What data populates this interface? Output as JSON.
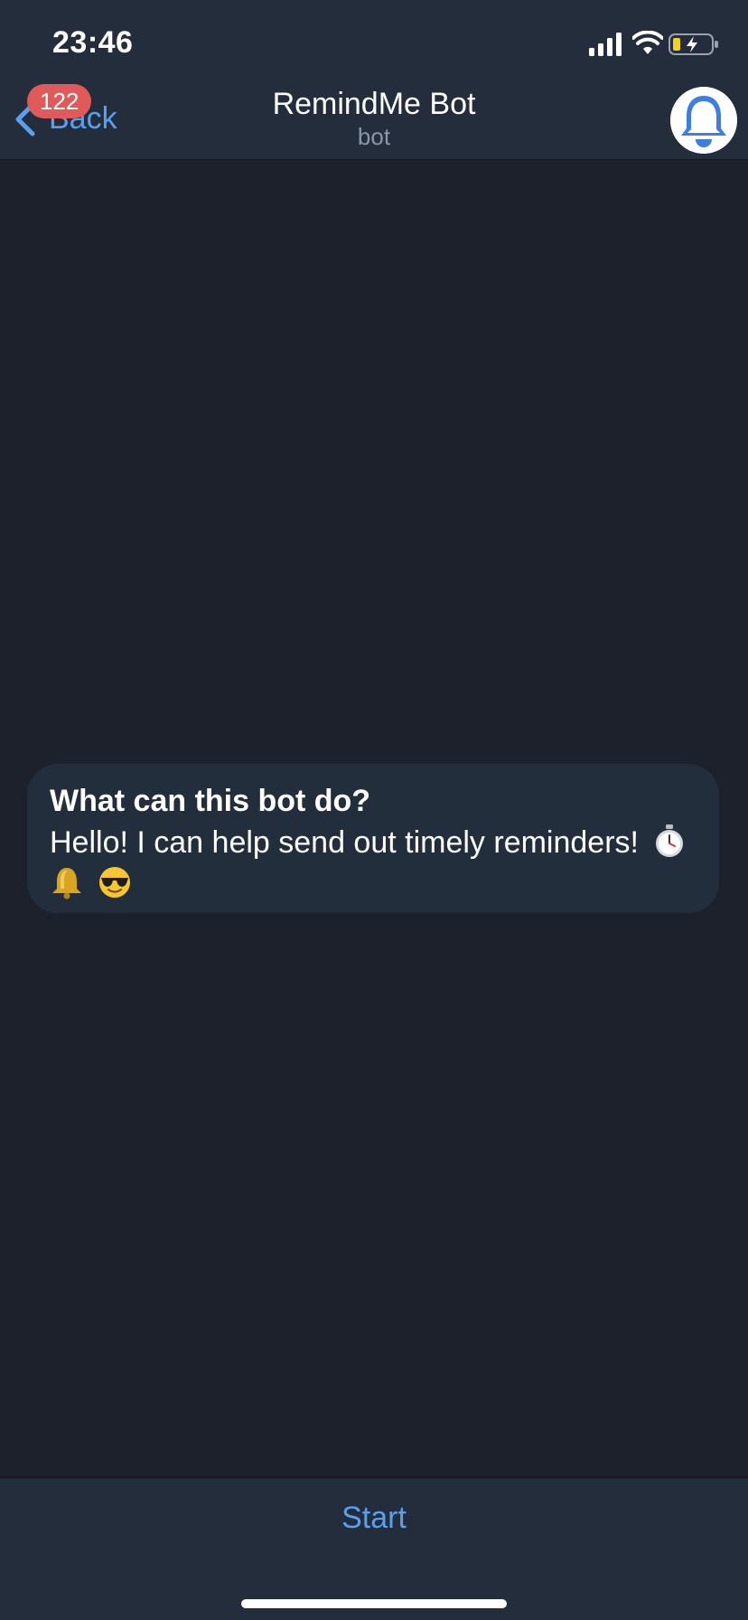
{
  "status_bar": {
    "time": "23:46",
    "icons": [
      "signal-icon",
      "wifi-icon",
      "battery-charging-icon"
    ]
  },
  "header": {
    "back_label": "Back",
    "unread_count": "122",
    "title": "RemindMe Bot",
    "subtitle": "bot",
    "avatar_icon": "bell-icon"
  },
  "bot_info": {
    "heading": "What can this bot do?",
    "text": "Hello! I can help send out timely reminders!",
    "emojis": [
      "stopwatch-emoji",
      "bell-emoji",
      "sunglasses-emoji"
    ]
  },
  "bottom_bar": {
    "start_label": "Start"
  },
  "colors": {
    "background": "#1c212b",
    "bar": "#232d3b",
    "bubble": "#232e3c",
    "accent": "#5aa0f0",
    "badge": "#e05a5a",
    "subtitle": "#8a97a8"
  }
}
